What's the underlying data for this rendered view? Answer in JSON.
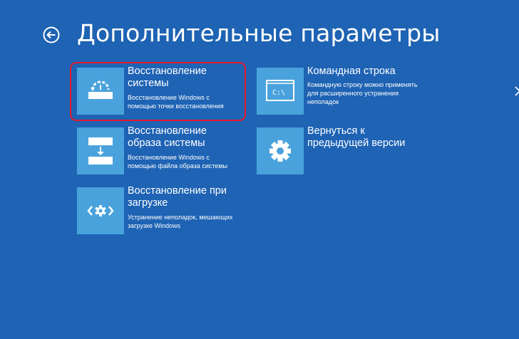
{
  "header": {
    "title": "Дополнительные параметры",
    "back_icon": "back-arrow-circle-icon"
  },
  "colors": {
    "background": "#1e63b4",
    "tile": "#4aa2dd",
    "highlight": "#e3172b",
    "text": "#ffffff"
  },
  "tiles": [
    {
      "id": "system-restore",
      "icon": "system-restore-icon",
      "title": "Восстановление\nсистемы",
      "description": "Восстановление Windows с\nпомощью точки восстановления",
      "highlighted": true
    },
    {
      "id": "command-prompt",
      "icon": "command-prompt-icon",
      "icon_text": "C:\\",
      "title": "Командная строка",
      "description": "Командную строку можно применять\nдля расширенного устранения\nнеполадок"
    },
    {
      "id": "system-image-recovery",
      "icon": "system-image-icon",
      "title": "Восстановление\nобраза системы",
      "description": "Восстановление Windows с\nпомощью файла образа системы"
    },
    {
      "id": "go-back",
      "icon": "gear-icon",
      "title": "Вернуться к\nпредыдущей версии",
      "description": ""
    },
    {
      "id": "startup-repair",
      "icon": "startup-repair-icon",
      "title": "Восстановление при\nзагрузке",
      "description": "Устранение неполадок, мешающих\nзагрузке Windows"
    }
  ],
  "scroll": {
    "icon": "chevron-right-icon"
  }
}
